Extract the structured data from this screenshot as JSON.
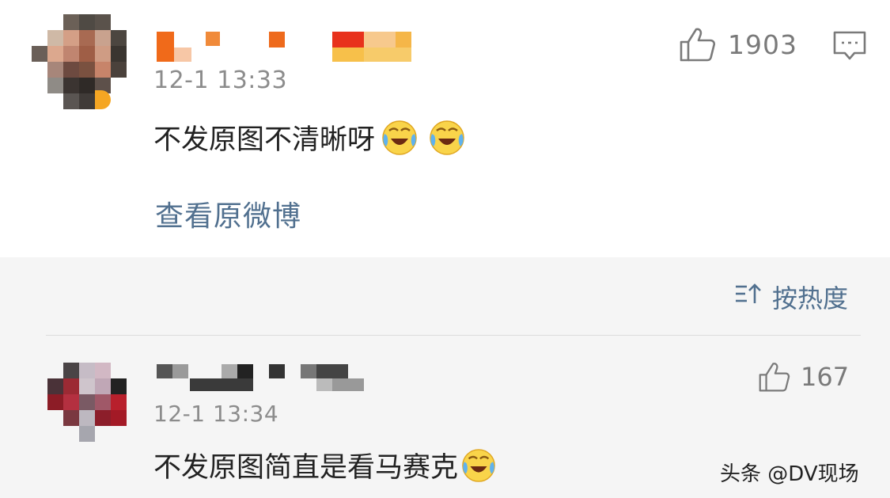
{
  "top_comment": {
    "time": "12-1 13:33",
    "text": "不发原图不清晰呀",
    "likes": "1903",
    "view_original": "查看原微博"
  },
  "sort_label": "按热度",
  "reply": {
    "time": "12-1 13:34",
    "text": "不发原图简直是看马赛克",
    "likes": "167"
  },
  "watermark": "头条 @DV现场",
  "colors": {
    "link": "#51708f",
    "muted": "#8c8c8c",
    "text": "#222222"
  }
}
